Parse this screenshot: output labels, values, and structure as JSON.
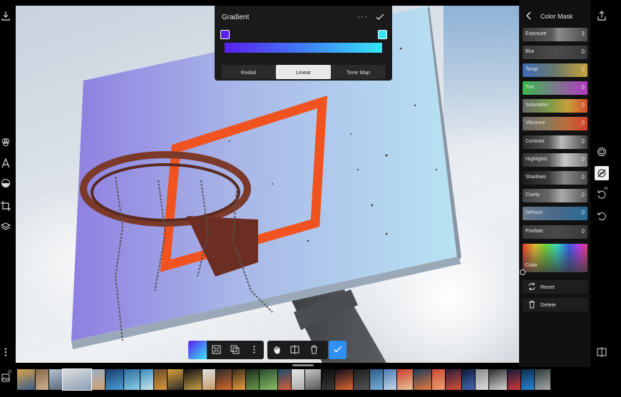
{
  "left_toolbar": {
    "items": [
      {
        "name": "export-icon"
      },
      {
        "name": "color-blend-icon"
      },
      {
        "name": "text-icon"
      },
      {
        "name": "mask-icon"
      },
      {
        "name": "crop-icon"
      },
      {
        "name": "layers-icon"
      },
      {
        "name": "more-vertical-icon"
      }
    ]
  },
  "gradient_panel": {
    "title": "Gradient",
    "more": "···",
    "tabs": [
      {
        "label": "Radial"
      },
      {
        "label": "Linear"
      },
      {
        "label": "Tone Map"
      }
    ],
    "active_tab": "Linear",
    "stops": [
      "#5b1ff0",
      "#38e6f7"
    ]
  },
  "floating_toolbar": {
    "items": [
      "gradient-swatch",
      "fit-icon",
      "duplicate-icon",
      "more-vertical-icon",
      "pan-hand-icon",
      "compare-icon",
      "trash-icon",
      "confirm-check-icon"
    ]
  },
  "right_panel": {
    "title": "Color Mask",
    "sliders": [
      {
        "label": "Exposure",
        "value": "3"
      },
      {
        "label": "Blur",
        "value": "0"
      },
      {
        "label": "Temp",
        "value": "0"
      },
      {
        "label": "Tint",
        "value": "0"
      },
      {
        "label": "Saturation",
        "value": "0"
      },
      {
        "label": "Vibrance",
        "value": "0"
      },
      {
        "label": "Contrast",
        "value": "0"
      },
      {
        "label": "Highlights",
        "value": "0"
      },
      {
        "label": "Shadows",
        "value": "0"
      },
      {
        "label": "Clarity",
        "value": "0"
      },
      {
        "label": "Dehaze",
        "value": "0"
      },
      {
        "label": "Pixelate",
        "value": "0"
      }
    ],
    "color_label": "Color",
    "reset_label": "Reset",
    "delete_label": "Delete"
  },
  "far_right_tools": {
    "badge_count": "16"
  },
  "filmstrip": {
    "badge": "21",
    "thumbnails": 40,
    "selected_index": 3
  }
}
